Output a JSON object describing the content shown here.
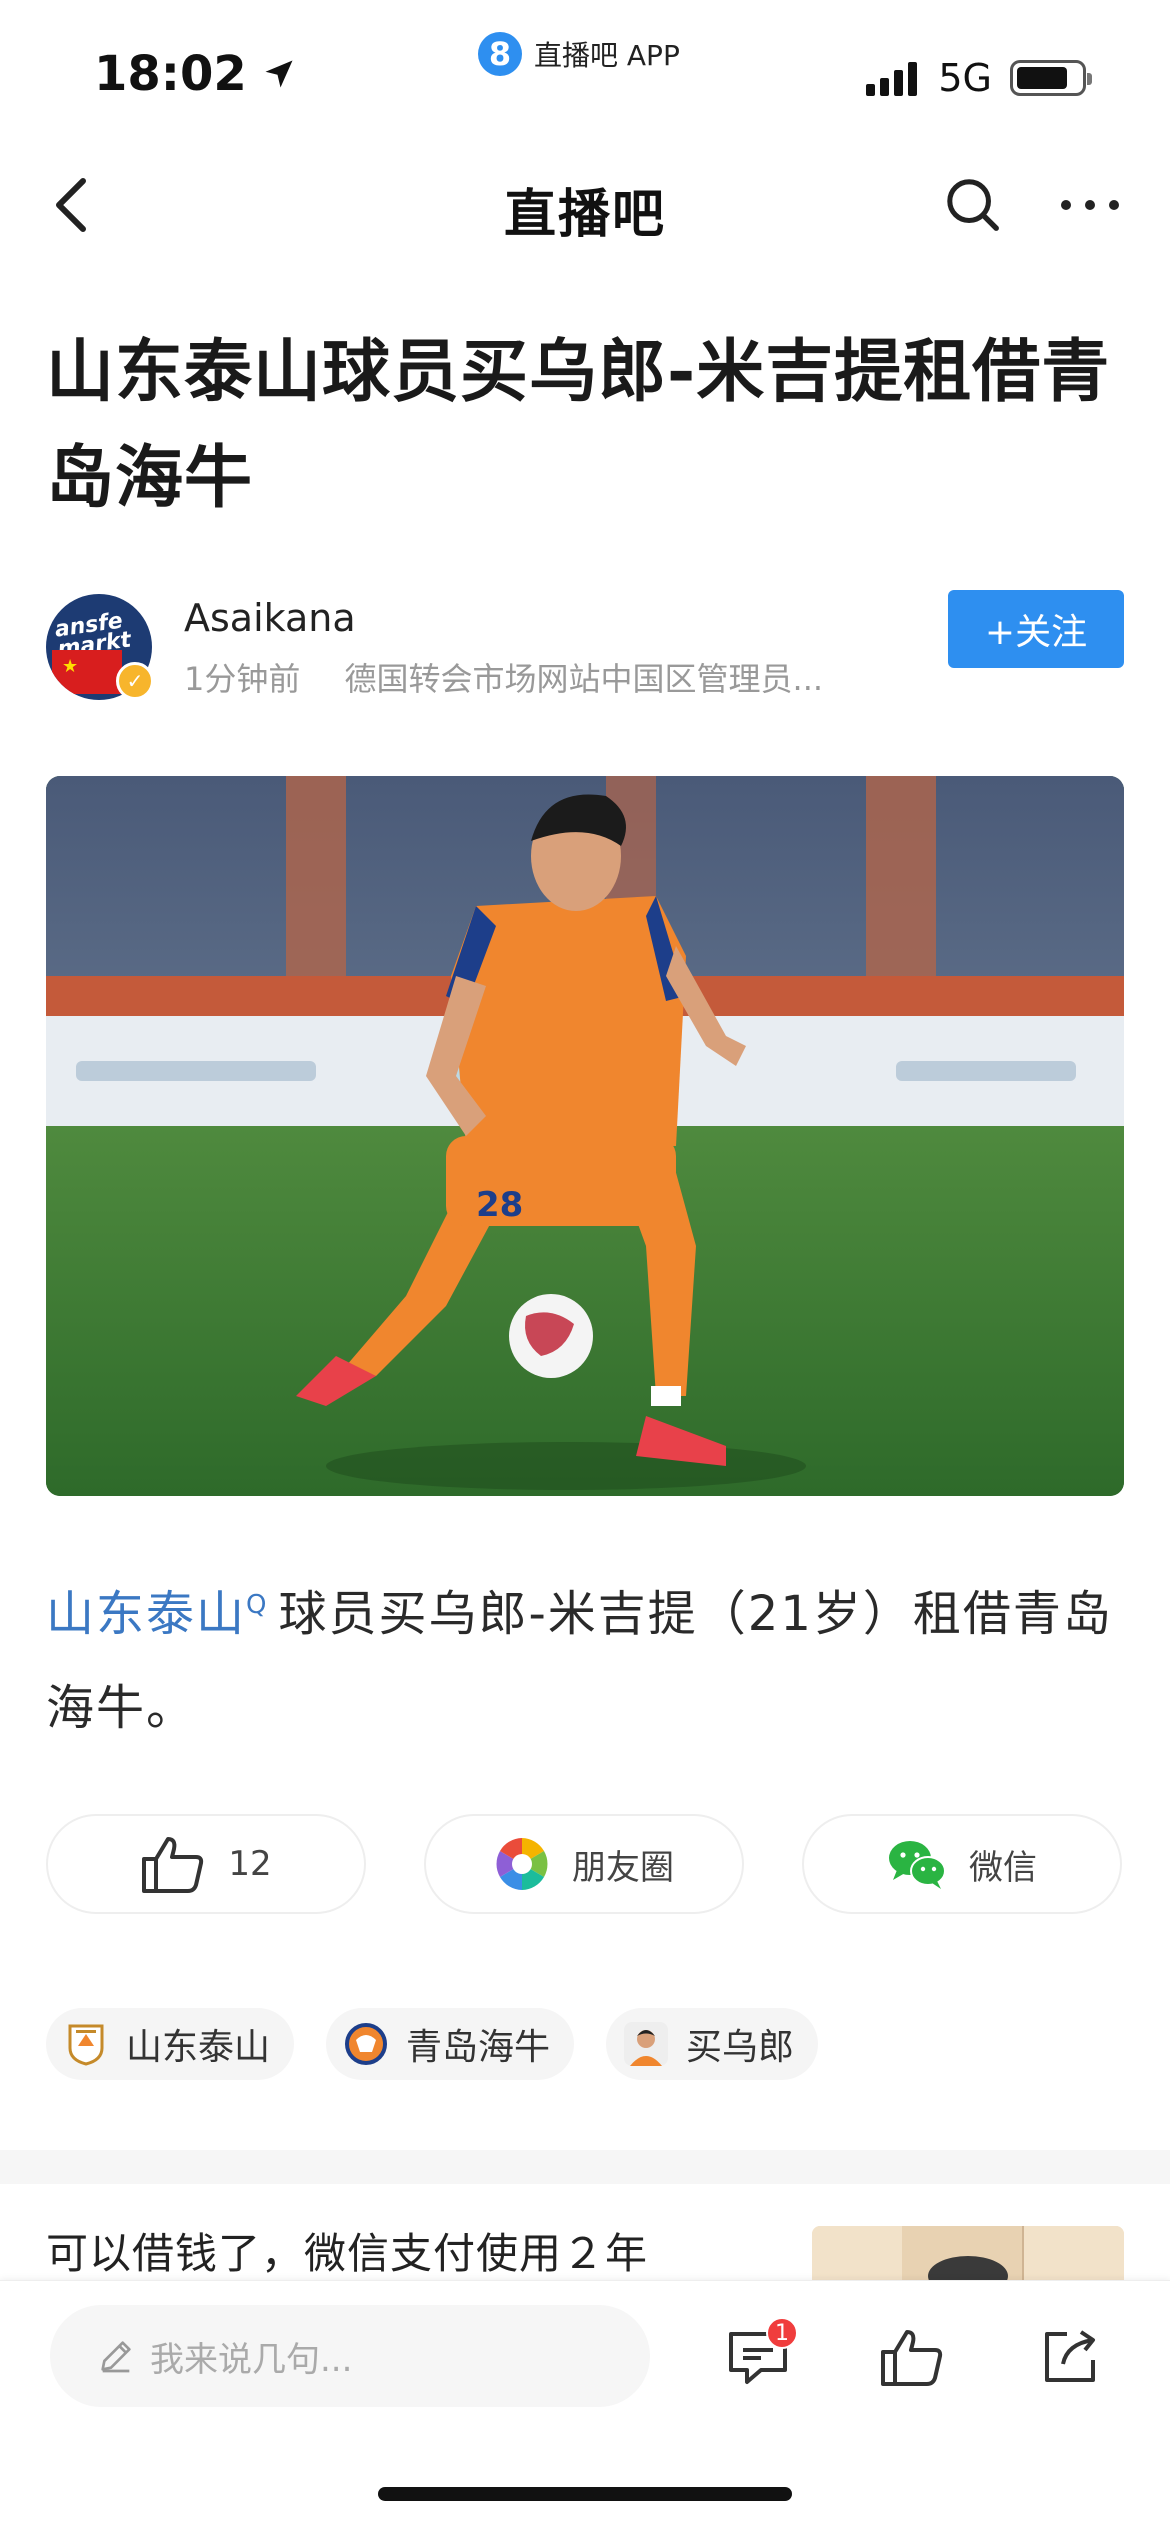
{
  "status_bar": {
    "time": "18:02",
    "app_label": "直播吧 APP",
    "app_badge": "8",
    "network": "5G"
  },
  "nav": {
    "title": "直播吧"
  },
  "article": {
    "title": "山东泰山球员买乌郎-米吉提租借青岛海牛",
    "author": {
      "name": "Asaikana",
      "time": "1分钟前",
      "description": "德国转会市场网站中国区管理员...",
      "avatar_text": "ansfe markt",
      "follow_label": "+关注"
    },
    "body": {
      "link_text": "山东泰山",
      "text": "球员买乌郎-米吉提（21岁）租借青岛海牛。"
    }
  },
  "share": {
    "like_count": "12",
    "moments_label": "朋友圈",
    "wechat_label": "微信"
  },
  "tags": [
    {
      "label": "山东泰山",
      "icon": "shandong-taishan-crest-icon"
    },
    {
      "label": "青岛海牛",
      "icon": "qingdao-hainiu-crest-icon"
    },
    {
      "label": "买乌郎",
      "icon": "player-avatar-icon"
    }
  ],
  "recommend": {
    "title": "可以借钱了，微信支付使用２年"
  },
  "bottom_bar": {
    "comment_placeholder": "我来说几句...",
    "comment_badge": "1"
  },
  "colors": {
    "accent": "#2e8ff0",
    "link": "#3b78c3",
    "jersey": "#f0862e",
    "badge": "#f03d3d"
  }
}
